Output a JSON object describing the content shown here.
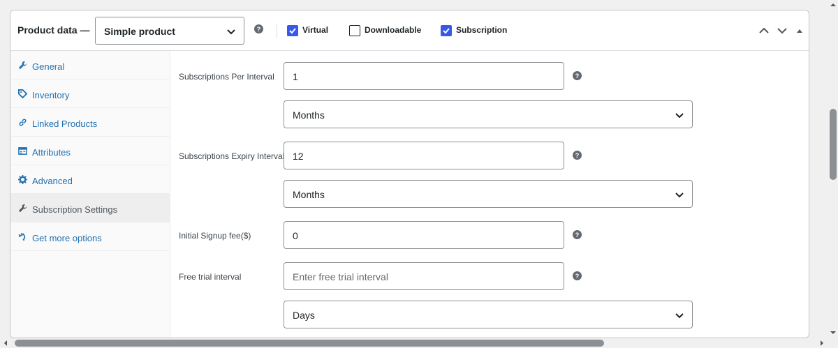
{
  "header": {
    "title": "Product data —",
    "product_type": "Simple product",
    "checkboxes": [
      {
        "label": "Virtual",
        "checked": true
      },
      {
        "label": "Downloadable",
        "checked": false
      },
      {
        "label": "Subscription",
        "checked": true
      }
    ]
  },
  "tabs": [
    {
      "label": "General",
      "icon": "wrench-icon"
    },
    {
      "label": "Inventory",
      "icon": "tag-icon"
    },
    {
      "label": "Linked Products",
      "icon": "link-icon"
    },
    {
      "label": "Attributes",
      "icon": "table-icon"
    },
    {
      "label": "Advanced",
      "icon": "gear-icon"
    },
    {
      "label": "Subscription Settings",
      "icon": "wrench-icon",
      "active": true
    },
    {
      "label": "Get more options",
      "icon": "plugin-icon"
    }
  ],
  "fields": {
    "per_interval": {
      "label": "Subscriptions Per Interval",
      "value": "1",
      "unit": "Months"
    },
    "expiry_interval": {
      "label": "Subscriptions Expiry Interval",
      "value": "12",
      "unit": "Months"
    },
    "signup_fee": {
      "label": "Initial Signup fee($)",
      "value": "0"
    },
    "free_trial": {
      "label": "Free trial interval",
      "placeholder": "Enter free trial interval",
      "unit": "Days"
    }
  },
  "colors": {
    "accent": "#3858e9",
    "link": "#2271b1"
  }
}
